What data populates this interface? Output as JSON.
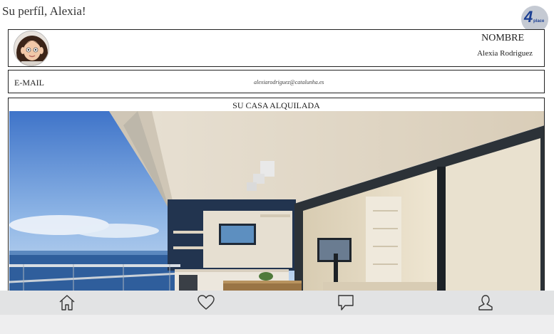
{
  "header": {
    "greeting": "Su perfíl, Alexia!",
    "logo": {
      "number": "4",
      "word": "place",
      "color": "#1b3f93"
    }
  },
  "profile": {
    "name_label": "NOMBRE",
    "name_value": "Alexia Rodriguez"
  },
  "email": {
    "label": "E-MAIL",
    "value": "alexiarodriguez@catalunha.es"
  },
  "house": {
    "title": "SU CASA ALQUILADA"
  },
  "bottom_nav": {
    "items": [
      "home-icon",
      "heart-icon",
      "chat-bubble-icon",
      "profile-icon"
    ]
  },
  "colors": {
    "nav_background": "#e2e3e4",
    "border": "#222222"
  }
}
